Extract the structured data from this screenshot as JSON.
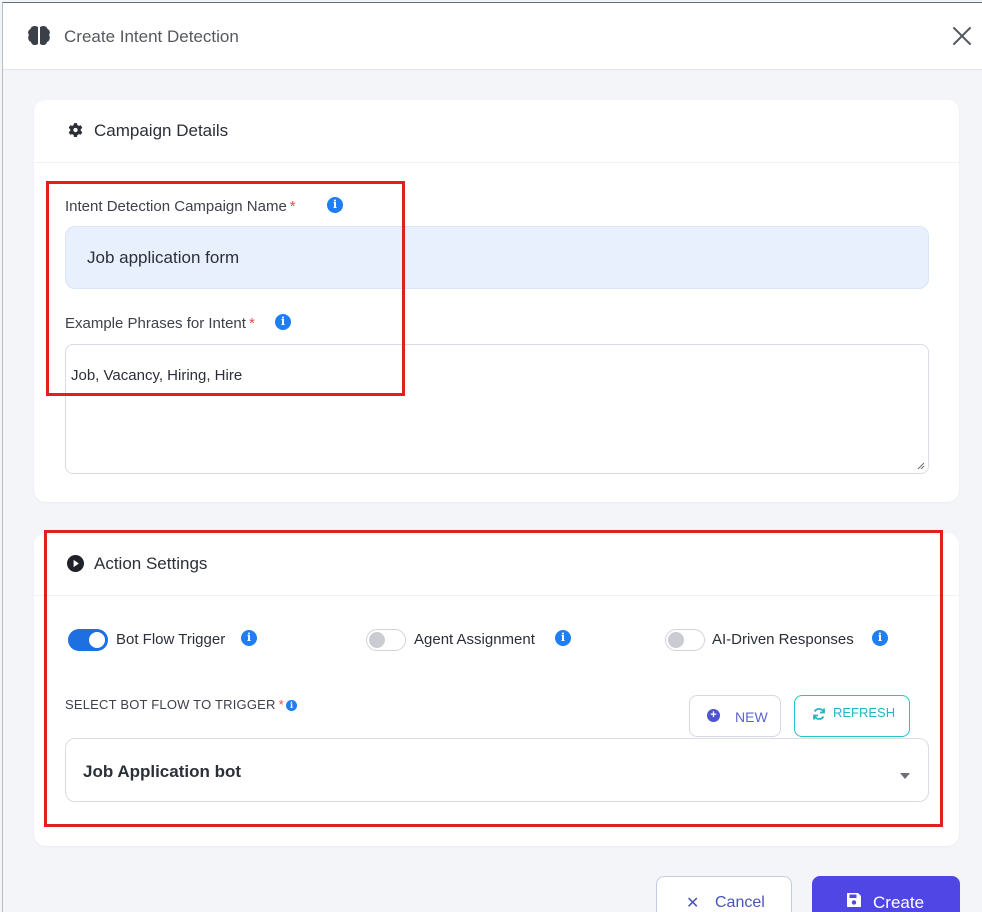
{
  "header": {
    "title": "Create Intent Detection"
  },
  "campaign": {
    "section_title": "Campaign Details",
    "name_label": "Intent Detection Campaign Name",
    "name_value": "Job application form",
    "phrases_label": "Example Phrases for Intent",
    "phrases_value": "Job, Vacancy, Hiring, Hire",
    "required_mark": "*"
  },
  "actions": {
    "section_title": "Action Settings",
    "toggles": [
      {
        "label": "Bot Flow Trigger",
        "on": true
      },
      {
        "label": "Agent Assignment",
        "on": false
      },
      {
        "label": "AI-Driven Responses",
        "on": false
      }
    ],
    "select_label": "SELECT BOT FLOW TO TRIGGER",
    "new_label": "NEW",
    "refresh_label": "REFRESH",
    "selected_flow": "Job Application bot"
  },
  "footer": {
    "cancel_label": "Cancel",
    "create_label": "Create"
  },
  "colors": {
    "primary": "#5046e5",
    "info": "#1e7ef2",
    "toggle_on": "#1e6fe0",
    "refresh": "#26c3c9",
    "highlight": "#e0201c",
    "required": "#e5484d"
  }
}
